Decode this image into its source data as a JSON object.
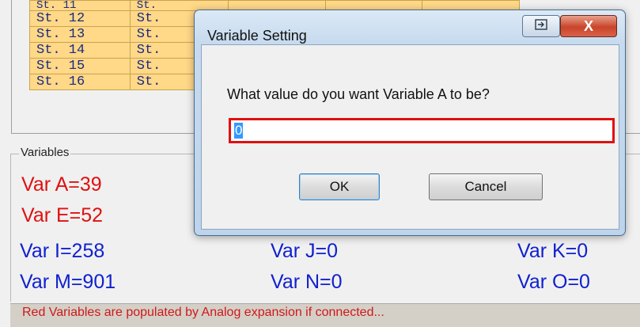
{
  "stations": {
    "rows": [
      [
        "St. 11",
        "St."
      ],
      [
        "St. 12",
        "St."
      ],
      [
        "St. 13",
        "St."
      ],
      [
        "St. 14",
        "St."
      ],
      [
        "St. 15",
        "St."
      ],
      [
        "St. 16",
        "St."
      ]
    ]
  },
  "variables": {
    "group_title": "Variables",
    "items": [
      {
        "label": "Var A=39",
        "color": "#e01010"
      },
      {
        "label": "Var E=52",
        "color": "#e01010"
      },
      {
        "label": "Var I=258",
        "color": "#1020d0"
      },
      {
        "label": "Var J=0",
        "color": "#1020d0"
      },
      {
        "label": "Var K=0",
        "color": "#1020d0"
      },
      {
        "label": "Var M=901",
        "color": "#1020d0"
      },
      {
        "label": "Var N=0",
        "color": "#1020d0"
      },
      {
        "label": "Var O=0",
        "color": "#1020d0"
      }
    ],
    "status": "Red Variables are populated by Analog expansion if connected..."
  },
  "dialog": {
    "title": "Variable Setting",
    "prompt": "What value do you want Variable A to be?",
    "input_value": "0",
    "ok_label": "OK",
    "cancel_label": "Cancel",
    "close_glyph": "X",
    "restore_icon": "restore-icon"
  },
  "colors": {
    "station_cell": "#ffd888",
    "highlight_border": "#e01010"
  }
}
